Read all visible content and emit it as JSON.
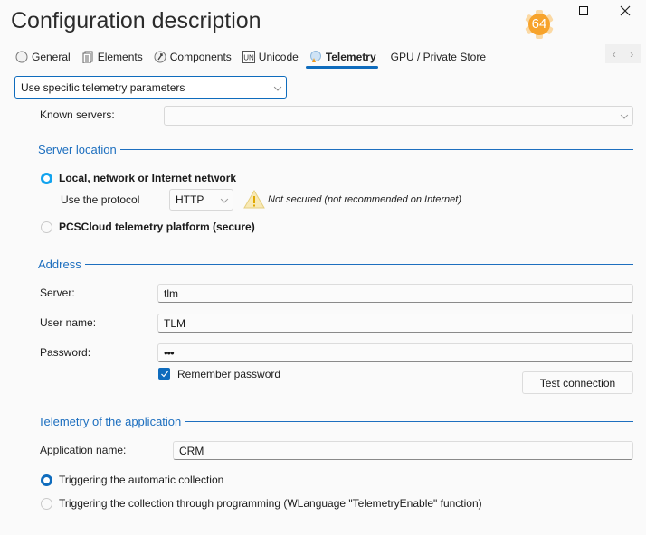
{
  "window": {
    "title": "Configuration description",
    "badge_label": "64",
    "maximize_icon": "maximize-icon",
    "close_icon": "close-icon"
  },
  "tabs": [
    {
      "label": "General",
      "icon": "general-icon",
      "active": false
    },
    {
      "label": "Elements",
      "icon": "elements-icon",
      "active": false
    },
    {
      "label": "Components",
      "icon": "components-icon",
      "active": false
    },
    {
      "label": "Unicode",
      "icon": "unicode-icon",
      "active": false
    },
    {
      "label": "Telemetry",
      "icon": "telemetry-icon",
      "active": true
    },
    {
      "label": "GPU / Private Store",
      "icon": "",
      "active": false
    }
  ],
  "tab_nav": {
    "prev": "‹",
    "next": "›"
  },
  "mode_combo": {
    "value": "Use specific telemetry parameters"
  },
  "known_servers": {
    "label": "Known servers:",
    "value": ""
  },
  "server_location": {
    "title": "Server location",
    "option_local": {
      "label": "Local, network or Internet network",
      "selected": true
    },
    "protocol_label": "Use the protocol",
    "protocol_value": "HTTP",
    "warning_text": "Not secured (not recommended on Internet)",
    "option_cloud": {
      "label": "PCSCloud telemetry platform (secure)",
      "selected": false
    }
  },
  "address": {
    "title": "Address",
    "server_label": "Server:",
    "server_value": "tlm",
    "username_label": "User name:",
    "username_value": "TLM",
    "password_label": "Password:",
    "password_value": "•••",
    "remember_label": "Remember password",
    "remember_checked": true,
    "test_button": "Test connection"
  },
  "telemetry_app": {
    "title": "Telemetry of the application",
    "appname_label": "Application name:",
    "appname_value": "CRM",
    "option_auto": {
      "label": "Triggering the automatic collection",
      "selected": true
    },
    "option_prog": {
      "label": "Triggering the collection through programming (WLanguage \"TelemetryEnable\" function)",
      "selected": false
    }
  },
  "colors": {
    "accent": "#0f6cbd",
    "section_title": "#1d6fbf",
    "badge": "#f7a32b",
    "warning": "#f3e3a3"
  }
}
